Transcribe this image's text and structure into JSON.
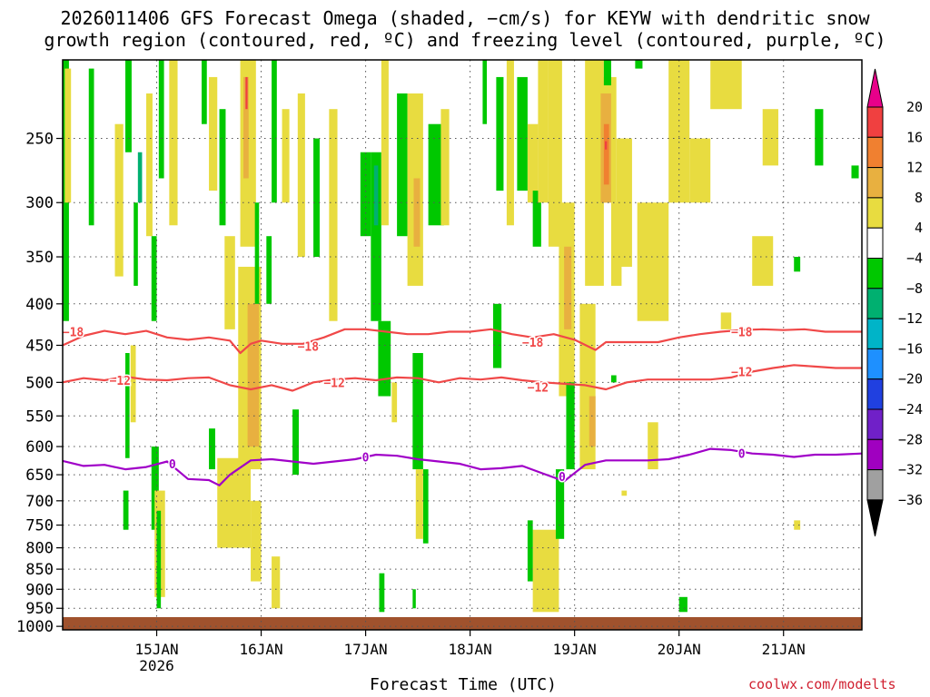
{
  "chart_data": {
    "type": "heatmap",
    "title_line1": "2026011406 GFS Forecast Omega (shaded, −cm/s) for KEYW with dendritic snow",
    "title_line2": "growth region (contoured, red, ºC) and freezing level (contoured, purple, ºC)",
    "xlabel": "Forecast Time (UTC)",
    "credit": "coolwx.com/modelts",
    "x_ticks": [
      {
        "t": 1,
        "label": "15JAN",
        "sublabel": "2026"
      },
      {
        "t": 2,
        "label": "16JAN",
        "sublabel": ""
      },
      {
        "t": 3,
        "label": "17JAN",
        "sublabel": ""
      },
      {
        "t": 4,
        "label": "18JAN",
        "sublabel": ""
      },
      {
        "t": 5,
        "label": "19JAN",
        "sublabel": ""
      },
      {
        "t": 6,
        "label": "20JAN",
        "sublabel": ""
      },
      {
        "t": 7,
        "label": "21JAN",
        "sublabel": ""
      }
    ],
    "xlim": [
      0.1,
      7.75
    ],
    "y_ticks": [
      250,
      300,
      350,
      400,
      450,
      500,
      550,
      600,
      650,
      700,
      750,
      800,
      850,
      900,
      950,
      1000
    ],
    "ylim_hpa": [
      1010,
      200
    ],
    "y_scale": "log-pressure",
    "grid": true,
    "colorbar": {
      "labels": [
        "20",
        "16",
        "12",
        "8",
        "4",
        "−4",
        "−8",
        "−12",
        "−16",
        "−20",
        "−24",
        "−28",
        "−32",
        "−36"
      ],
      "colors": [
        "#e8008a",
        "#f04040",
        "#f08030",
        "#e8b040",
        "#e8dc40",
        "#ffffff",
        "#00c800",
        "#00b070",
        "#00b4c8",
        "#1e90ff",
        "#2040e0",
        "#7020c8",
        "#a000c0",
        "#a0a0a0",
        "#000000"
      ]
    },
    "shade_colors": {
      "pos4": "#e8dc40",
      "pos8": "#e8b040",
      "pos12": "#f08030",
      "pos16": "#f04040",
      "neg4": "#00c800",
      "neg8": "#00b070"
    },
    "ground_color": "#a0522d",
    "series": [
      {
        "name": "-18",
        "color": "#f04848",
        "x": [
          0.1,
          0.3,
          0.5,
          0.7,
          0.9,
          1.1,
          1.3,
          1.5,
          1.7,
          1.8,
          1.9,
          2.0,
          2.2,
          2.4,
          2.6,
          2.8,
          3.0,
          3.2,
          3.4,
          3.6,
          3.8,
          4.0,
          4.2,
          4.4,
          4.6,
          4.8,
          5.0,
          5.2,
          5.3,
          5.5,
          5.8,
          6.0,
          6.2,
          6.4,
          6.6,
          6.8,
          7.0,
          7.2,
          7.4,
          7.75
        ],
        "y": [
          450,
          438,
          432,
          436,
          432,
          440,
          443,
          440,
          444,
          460,
          448,
          444,
          448,
          448,
          440,
          430,
          430,
          433,
          436,
          436,
          433,
          433,
          430,
          436,
          440,
          436,
          443,
          456,
          446,
          446,
          446,
          440,
          436,
          433,
          431,
          430,
          431,
          430,
          433,
          433
        ]
      },
      {
        "name": "-12",
        "color": "#f04848",
        "x": [
          0.1,
          0.3,
          0.5,
          0.7,
          0.9,
          1.1,
          1.3,
          1.5,
          1.7,
          1.9,
          2.1,
          2.3,
          2.5,
          2.7,
          2.9,
          3.1,
          3.3,
          3.5,
          3.7,
          3.9,
          4.1,
          4.3,
          4.5,
          4.7,
          4.9,
          5.1,
          5.3,
          5.5,
          5.7,
          5.9,
          6.1,
          6.3,
          6.5,
          6.7,
          6.9,
          7.1,
          7.3,
          7.5,
          7.75
        ],
        "y": [
          500,
          494,
          497,
          492,
          496,
          497,
          494,
          493,
          504,
          510,
          504,
          512,
          500,
          496,
          494,
          497,
          493,
          494,
          500,
          494,
          496,
          493,
          497,
          500,
          502,
          504,
          510,
          500,
          496,
          496,
          496,
          496,
          493,
          485,
          480,
          476,
          478,
          480,
          480
        ]
      },
      {
        "name": "0",
        "color": "#a000c8",
        "x": [
          0.1,
          0.3,
          0.5,
          0.7,
          0.9,
          1.1,
          1.3,
          1.5,
          1.6,
          1.7,
          1.9,
          2.1,
          2.3,
          2.5,
          2.7,
          2.9,
          3.1,
          3.3,
          3.5,
          3.7,
          3.9,
          4.1,
          4.3,
          4.5,
          4.7,
          4.9,
          5.1,
          5.3,
          5.5,
          5.7,
          5.9,
          6.1,
          6.3,
          6.5,
          6.7,
          6.9,
          7.1,
          7.3,
          7.5,
          7.75
        ],
        "y": [
          625,
          634,
          632,
          640,
          636,
          626,
          658,
          660,
          670,
          650,
          624,
          622,
          626,
          630,
          626,
          622,
          614,
          616,
          622,
          626,
          630,
          640,
          638,
          634,
          648,
          662,
          632,
          624,
          624,
          624,
          622,
          614,
          604,
          606,
          612,
          614,
          618,
          614,
          614,
          612
        ]
      }
    ],
    "contour_labels": [
      {
        "text": "−18",
        "x": 0.2,
        "y": 433,
        "color": "#f04848"
      },
      {
        "text": "−18",
        "x": 2.45,
        "y": 451,
        "color": "#f04848"
      },
      {
        "text": "−18",
        "x": 4.6,
        "y": 446,
        "color": "#f04848"
      },
      {
        "text": "−18",
        "x": 6.6,
        "y": 433,
        "color": "#f04848"
      },
      {
        "text": "−12",
        "x": 0.65,
        "y": 497,
        "color": "#f04848"
      },
      {
        "text": "−12",
        "x": 2.7,
        "y": 500,
        "color": "#f04848"
      },
      {
        "text": "−12",
        "x": 4.65,
        "y": 507,
        "color": "#f04848"
      },
      {
        "text": "−12",
        "x": 6.6,
        "y": 485,
        "color": "#f04848"
      },
      {
        "text": "0",
        "x": 1.15,
        "y": 630,
        "color": "#a000c8"
      },
      {
        "text": "0",
        "x": 3.0,
        "y": 618,
        "color": "#a000c8"
      },
      {
        "text": "0",
        "x": 4.88,
        "y": 653,
        "color": "#a000c8"
      },
      {
        "text": "0",
        "x": 6.6,
        "y": 612,
        "color": "#a000c8"
      }
    ],
    "shaded_regions": [
      {
        "c": "neg4",
        "x0": 0.1,
        "x1": 0.16,
        "p0": 200,
        "p1": 420
      },
      {
        "c": "neg4",
        "x0": 0.35,
        "x1": 0.4,
        "p0": 205,
        "p1": 320
      },
      {
        "c": "pos4",
        "x0": 0.12,
        "x1": 0.18,
        "p0": 205,
        "p1": 300
      },
      {
        "c": "pos4",
        "x0": 0.6,
        "x1": 0.68,
        "p0": 240,
        "p1": 370
      },
      {
        "c": "neg4",
        "x0": 0.7,
        "x1": 0.76,
        "p0": 200,
        "p1": 260
      },
      {
        "c": "neg8",
        "x0": 0.82,
        "x1": 0.86,
        "p0": 260,
        "p1": 300
      },
      {
        "c": "neg4",
        "x0": 0.78,
        "x1": 0.82,
        "p0": 300,
        "p1": 380
      },
      {
        "c": "pos4",
        "x0": 0.9,
        "x1": 0.96,
        "p0": 220,
        "p1": 330
      },
      {
        "c": "neg4",
        "x0": 1.02,
        "x1": 1.07,
        "p0": 200,
        "p1": 280
      },
      {
        "c": "pos4",
        "x0": 1.12,
        "x1": 1.2,
        "p0": 200,
        "p1": 320
      },
      {
        "c": "neg4",
        "x0": 0.95,
        "x1": 1.0,
        "p0": 330,
        "p1": 420
      },
      {
        "c": "neg4",
        "x0": 0.7,
        "x1": 0.74,
        "p0": 460,
        "p1": 620
      },
      {
        "c": "pos4",
        "x0": 0.75,
        "x1": 0.8,
        "p0": 450,
        "p1": 560
      },
      {
        "c": "neg4",
        "x0": 0.68,
        "x1": 0.73,
        "p0": 680,
        "p1": 760
      },
      {
        "c": "neg4",
        "x0": 0.95,
        "x1": 1.02,
        "p0": 600,
        "p1": 760
      },
      {
        "c": "pos4",
        "x0": 0.98,
        "x1": 1.08,
        "p0": 680,
        "p1": 920
      },
      {
        "c": "neg4",
        "x0": 1.0,
        "x1": 1.04,
        "p0": 720,
        "p1": 950
      },
      {
        "c": "pos4",
        "x0": 1.5,
        "x1": 1.58,
        "p0": 210,
        "p1": 290
      },
      {
        "c": "neg4",
        "x0": 1.6,
        "x1": 1.66,
        "p0": 230,
        "p1": 320
      },
      {
        "c": "neg4",
        "x0": 1.43,
        "x1": 1.48,
        "p0": 200,
        "p1": 240
      },
      {
        "c": "pos4",
        "x0": 1.65,
        "x1": 1.75,
        "p0": 330,
        "p1": 430
      },
      {
        "c": "pos4",
        "x0": 1.8,
        "x1": 1.95,
        "p0": 200,
        "p1": 340
      },
      {
        "c": "pos8",
        "x0": 1.83,
        "x1": 1.88,
        "p0": 210,
        "p1": 280
      },
      {
        "c": "pos16",
        "x0": 1.85,
        "x1": 1.87,
        "p0": 210,
        "p1": 230
      },
      {
        "c": "pos4",
        "x0": 1.78,
        "x1": 2.0,
        "p0": 360,
        "p1": 640
      },
      {
        "c": "pos8",
        "x0": 1.87,
        "x1": 1.98,
        "p0": 400,
        "p1": 600
      },
      {
        "c": "pos4",
        "x0": 1.58,
        "x1": 1.9,
        "p0": 620,
        "p1": 800
      },
      {
        "c": "pos4",
        "x0": 1.9,
        "x1": 2.0,
        "p0": 700,
        "p1": 880
      },
      {
        "c": "neg4",
        "x0": 1.5,
        "x1": 1.56,
        "p0": 570,
        "p1": 640
      },
      {
        "c": "neg4",
        "x0": 1.94,
        "x1": 1.98,
        "p0": 300,
        "p1": 400
      },
      {
        "c": "neg4",
        "x0": 2.1,
        "x1": 2.15,
        "p0": 200,
        "p1": 300
      },
      {
        "c": "pos4",
        "x0": 2.2,
        "x1": 2.27,
        "p0": 230,
        "p1": 300
      },
      {
        "c": "pos4",
        "x0": 2.35,
        "x1": 2.42,
        "p0": 220,
        "p1": 350
      },
      {
        "c": "pos4",
        "x0": 2.65,
        "x1": 2.73,
        "p0": 230,
        "p1": 420
      },
      {
        "c": "pos4",
        "x0": 2.1,
        "x1": 2.18,
        "p0": 820,
        "p1": 950
      },
      {
        "c": "neg4",
        "x0": 2.3,
        "x1": 2.36,
        "p0": 540,
        "p1": 650
      },
      {
        "c": "neg4",
        "x0": 2.5,
        "x1": 2.56,
        "p0": 250,
        "p1": 350
      },
      {
        "c": "neg4",
        "x0": 2.05,
        "x1": 2.1,
        "p0": 330,
        "p1": 400
      },
      {
        "c": "neg4",
        "x0": 2.95,
        "x1": 3.05,
        "p0": 260,
        "p1": 330
      },
      {
        "c": "neg4",
        "x0": 3.05,
        "x1": 3.15,
        "p0": 260,
        "p1": 420
      },
      {
        "c": "neg8",
        "x0": 3.08,
        "x1": 3.12,
        "p0": 270,
        "p1": 320
      },
      {
        "c": "pos4",
        "x0": 3.15,
        "x1": 3.22,
        "p0": 200,
        "p1": 320
      },
      {
        "c": "neg4",
        "x0": 3.12,
        "x1": 3.24,
        "p0": 420,
        "p1": 520
      },
      {
        "c": "pos4",
        "x0": 3.25,
        "x1": 3.3,
        "p0": 500,
        "p1": 560
      },
      {
        "c": "neg4",
        "x0": 3.3,
        "x1": 3.4,
        "p0": 220,
        "p1": 330
      },
      {
        "c": "pos4",
        "x0": 3.4,
        "x1": 3.55,
        "p0": 220,
        "p1": 380
      },
      {
        "c": "pos8",
        "x0": 3.46,
        "x1": 3.52,
        "p0": 280,
        "p1": 340
      },
      {
        "c": "neg4",
        "x0": 3.6,
        "x1": 3.75,
        "p0": 240,
        "p1": 320
      },
      {
        "c": "pos4",
        "x0": 3.72,
        "x1": 3.8,
        "p0": 230,
        "p1": 320
      },
      {
        "c": "neg4",
        "x0": 3.45,
        "x1": 3.55,
        "p0": 460,
        "p1": 640
      },
      {
        "c": "neg4",
        "x0": 3.55,
        "x1": 3.6,
        "p0": 640,
        "p1": 790
      },
      {
        "c": "pos4",
        "x0": 3.48,
        "x1": 3.55,
        "p0": 640,
        "p1": 780
      },
      {
        "c": "neg4",
        "x0": 3.13,
        "x1": 3.18,
        "p0": 860,
        "p1": 960
      },
      {
        "c": "neg4",
        "x0": 3.45,
        "x1": 3.48,
        "p0": 900,
        "p1": 950
      },
      {
        "c": "neg4",
        "x0": 4.12,
        "x1": 4.16,
        "p0": 200,
        "p1": 240
      },
      {
        "c": "neg4",
        "x0": 4.25,
        "x1": 4.32,
        "p0": 210,
        "p1": 290
      },
      {
        "c": "neg4",
        "x0": 4.22,
        "x1": 4.3,
        "p0": 400,
        "p1": 480
      },
      {
        "c": "pos4",
        "x0": 4.35,
        "x1": 4.42,
        "p0": 200,
        "p1": 320
      },
      {
        "c": "neg4",
        "x0": 4.45,
        "x1": 4.55,
        "p0": 210,
        "p1": 290
      },
      {
        "c": "pos4",
        "x0": 4.55,
        "x1": 4.65,
        "p0": 240,
        "p1": 300
      },
      {
        "c": "neg4",
        "x0": 4.6,
        "x1": 4.68,
        "p0": 290,
        "p1": 340
      },
      {
        "c": "pos4",
        "x0": 4.65,
        "x1": 4.75,
        "p0": 200,
        "p1": 300
      },
      {
        "c": "pos4",
        "x0": 4.75,
        "x1": 4.88,
        "p0": 200,
        "p1": 340
      },
      {
        "c": "pos4",
        "x0": 4.85,
        "x1": 5.0,
        "p0": 300,
        "p1": 520
      },
      {
        "c": "pos8",
        "x0": 4.9,
        "x1": 4.97,
        "p0": 340,
        "p1": 430
      },
      {
        "c": "pos4",
        "x0": 4.6,
        "x1": 4.85,
        "p0": 760,
        "p1": 960
      },
      {
        "c": "neg4",
        "x0": 4.55,
        "x1": 4.6,
        "p0": 740,
        "p1": 880
      },
      {
        "c": "neg4",
        "x0": 4.92,
        "x1": 5.0,
        "p0": 500,
        "p1": 640
      },
      {
        "c": "neg4",
        "x0": 4.82,
        "x1": 4.9,
        "p0": 640,
        "p1": 780
      },
      {
        "c": "pos4",
        "x0": 5.1,
        "x1": 5.28,
        "p0": 200,
        "p1": 380
      },
      {
        "c": "pos4",
        "x0": 5.05,
        "x1": 5.2,
        "p0": 400,
        "p1": 640
      },
      {
        "c": "pos8",
        "x0": 5.14,
        "x1": 5.2,
        "p0": 520,
        "p1": 600
      },
      {
        "c": "pos4",
        "x0": 5.25,
        "x1": 5.4,
        "p0": 210,
        "p1": 300
      },
      {
        "c": "pos8",
        "x0": 5.25,
        "x1": 5.35,
        "p0": 220,
        "p1": 300
      },
      {
        "c": "pos12",
        "x0": 5.28,
        "x1": 5.33,
        "p0": 240,
        "p1": 285
      },
      {
        "c": "pos16",
        "x0": 5.29,
        "x1": 5.31,
        "p0": 252,
        "p1": 258
      },
      {
        "c": "pos4",
        "x0": 5.35,
        "x1": 5.45,
        "p0": 300,
        "p1": 380
      },
      {
        "c": "pos4",
        "x0": 5.4,
        "x1": 5.55,
        "p0": 250,
        "p1": 360
      },
      {
        "c": "neg4",
        "x0": 5.28,
        "x1": 5.35,
        "p0": 200,
        "p1": 215
      },
      {
        "c": "pos4",
        "x0": 5.6,
        "x1": 5.9,
        "p0": 300,
        "p1": 420
      },
      {
        "c": "pos4",
        "x0": 5.7,
        "x1": 5.8,
        "p0": 560,
        "p1": 640
      },
      {
        "c": "pos4",
        "x0": 5.45,
        "x1": 5.5,
        "p0": 680,
        "p1": 690
      },
      {
        "c": "pos4",
        "x0": 5.9,
        "x1": 6.1,
        "p0": 200,
        "p1": 300
      },
      {
        "c": "pos4",
        "x0": 6.1,
        "x1": 6.3,
        "p0": 250,
        "p1": 300
      },
      {
        "c": "pos4",
        "x0": 6.3,
        "x1": 6.6,
        "p0": 200,
        "p1": 230
      },
      {
        "c": "pos4",
        "x0": 6.8,
        "x1": 6.95,
        "p0": 230,
        "p1": 270
      },
      {
        "c": "pos4",
        "x0": 6.7,
        "x1": 6.9,
        "p0": 330,
        "p1": 380
      },
      {
        "c": "pos4",
        "x0": 6.4,
        "x1": 6.5,
        "p0": 410,
        "p1": 430
      },
      {
        "c": "pos4",
        "x0": 7.1,
        "x1": 7.16,
        "p0": 740,
        "p1": 760
      },
      {
        "c": "neg4",
        "x0": 7.3,
        "x1": 7.38,
        "p0": 230,
        "p1": 270
      },
      {
        "c": "neg4",
        "x0": 7.65,
        "x1": 7.72,
        "p0": 270,
        "p1": 280
      },
      {
        "c": "neg4",
        "x0": 7.1,
        "x1": 7.16,
        "p0": 350,
        "p1": 365
      },
      {
        "c": "neg4",
        "x0": 6.0,
        "x1": 6.08,
        "p0": 920,
        "p1": 960
      },
      {
        "c": "neg4",
        "x0": 5.35,
        "x1": 5.4,
        "p0": 490,
        "p1": 500
      },
      {
        "c": "neg4",
        "x0": 5.58,
        "x1": 5.65,
        "p0": 200,
        "p1": 205
      }
    ]
  }
}
